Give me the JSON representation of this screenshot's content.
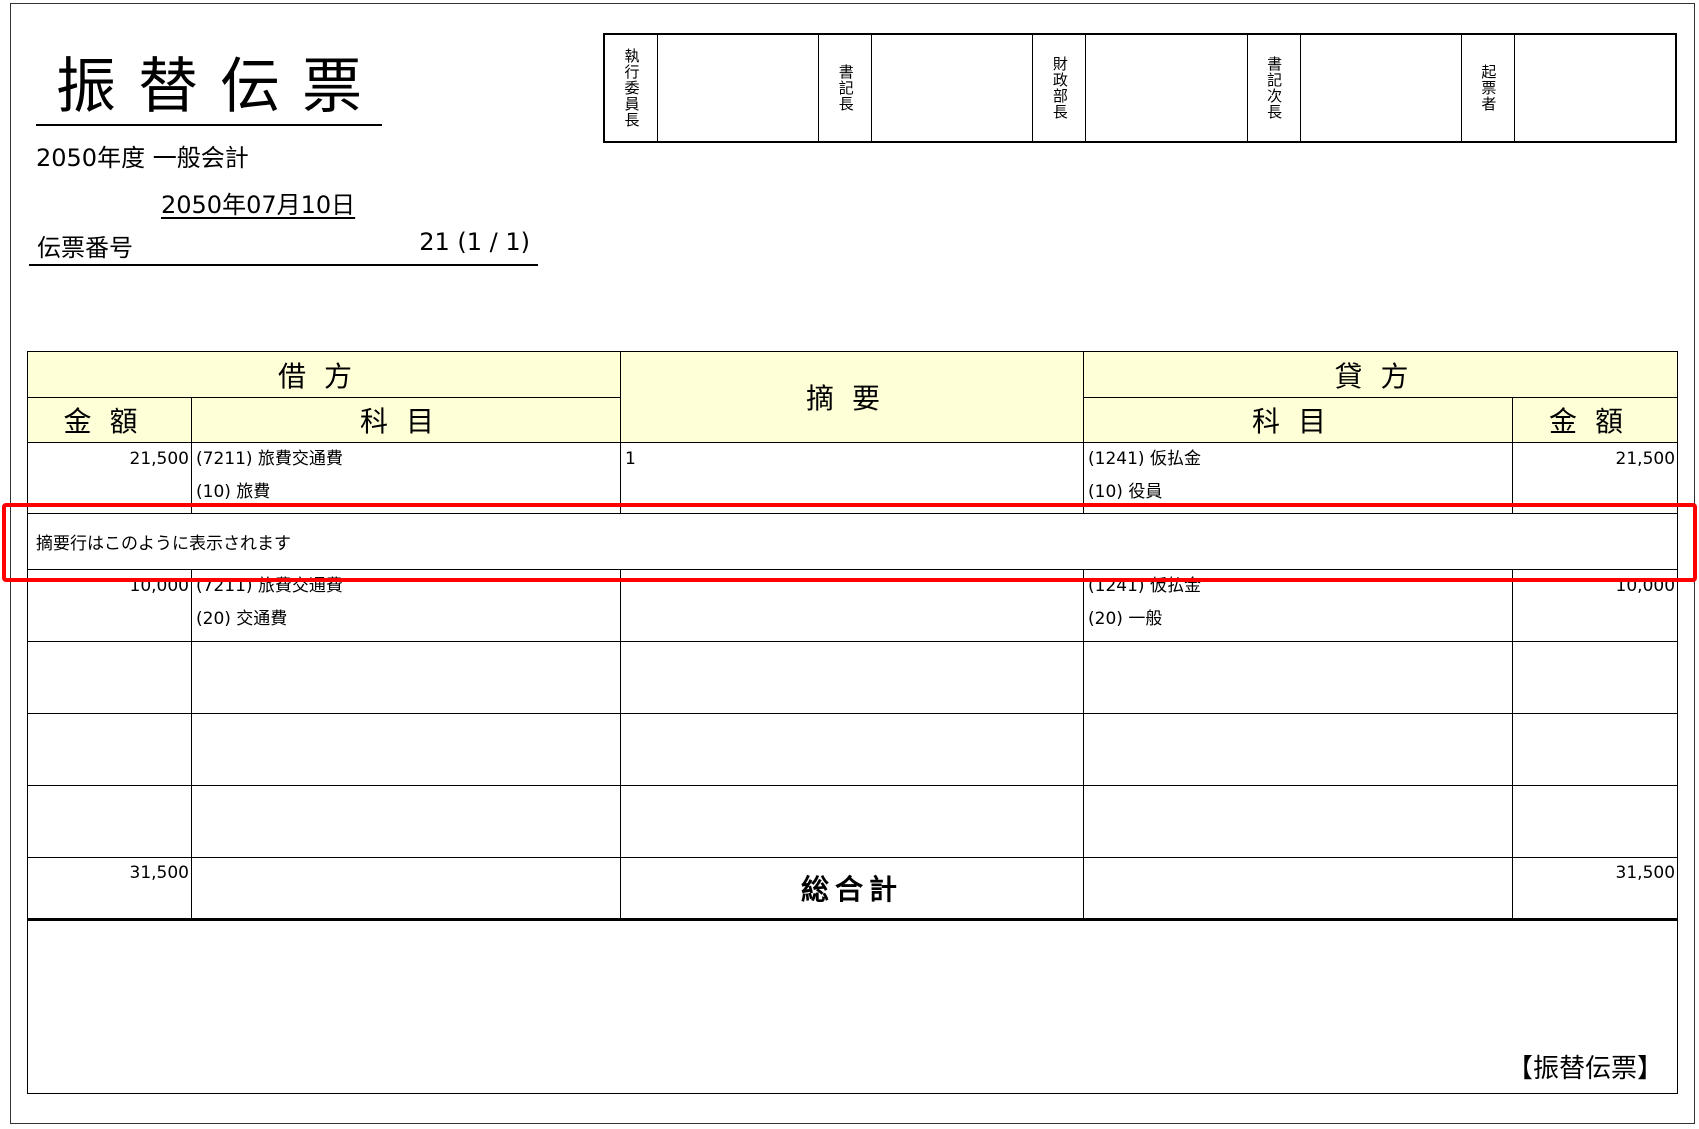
{
  "header": {
    "title": "振替伝票",
    "fiscal_year": "2050年度 一般会計",
    "date": "2050年07月10日",
    "slip_label": "伝票番号",
    "slip_value": "21 (1 / 1)"
  },
  "approvals": [
    "執行委員長",
    "書記長",
    "財政部長",
    "書記次長",
    "起票者"
  ],
  "table": {
    "debit_header": "借方",
    "memo_header": "摘要",
    "credit_header": "貸方",
    "amount_header": "金額",
    "account_header": "科目",
    "entries": [
      {
        "debit_amount": "21,500",
        "debit_account": "(7211) 旅費交通費",
        "debit_sub": "(10) 旅費",
        "memo": "1",
        "credit_account": "(1241) 仮払金",
        "credit_sub": "(10) 役員",
        "credit_amount": "21,500"
      },
      {
        "debit_amount": "10,000",
        "debit_account": "(7211) 旅費交通費",
        "debit_sub": "(20) 交通費",
        "memo": "",
        "credit_account": "(1241) 仮払金",
        "credit_sub": "(20) 一般",
        "credit_amount": "10,000"
      }
    ],
    "memo_line": "摘要行はこのように表示されます",
    "total_label": "総合計",
    "total_debit": "31,500",
    "total_credit": "31,500"
  },
  "footer_tag": "【振替伝票】",
  "colors": {
    "header_bg": "#ffffd7",
    "highlight": "#ff0000"
  }
}
